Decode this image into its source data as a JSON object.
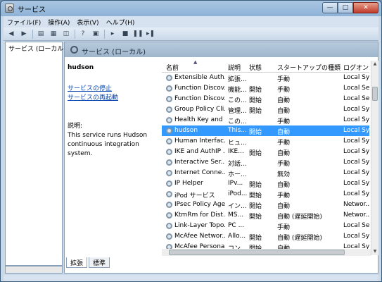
{
  "window": {
    "title": "サービス",
    "min": "—",
    "max": "□",
    "close": "✕"
  },
  "menu": [
    "ファイル(F)",
    "操作(A)",
    "表示(V)",
    "ヘルプ(H)"
  ],
  "toolbar": [
    "back-arrow-icon",
    "forward-arrow-icon",
    "console-tree-icon",
    "refresh-icon",
    "export-icon",
    "help-icon",
    "properties-icon",
    "play-icon",
    "stop-icon",
    "pause-icon",
    "restart-icon"
  ],
  "tree": {
    "root_label": "サービス (ローカル)"
  },
  "main": {
    "header": "サービス (ローカル)"
  },
  "extended": {
    "service_name": "hudson",
    "stop_link": "サービスの停止",
    "restart_link": "サービスの再起動",
    "desc_label": "説明:",
    "desc_text": "This service runs Hudson continuous integration system."
  },
  "columns": {
    "name": "名前",
    "desc": "説明",
    "status": "状態",
    "startup": "スタートアップの種類",
    "logon": "ログオン"
  },
  "rows": [
    {
      "name": "Extensible Auth...",
      "desc": "拡張...",
      "status": "",
      "startup": "手動",
      "logon": "Local Sy..."
    },
    {
      "name": "Function Discov...",
      "desc": "機能...",
      "status": "開始",
      "startup": "手動",
      "logon": "Local Se..."
    },
    {
      "name": "Function Discov...",
      "desc": "この...",
      "status": "開始",
      "startup": "自動",
      "logon": "Local Se..."
    },
    {
      "name": "Group Policy Cli...",
      "desc": "管理...",
      "status": "開始",
      "startup": "自動",
      "logon": "Local Sy..."
    },
    {
      "name": "Health Key and ...",
      "desc": "この...",
      "status": "",
      "startup": "手動",
      "logon": "Local Sy..."
    },
    {
      "name": "hudson",
      "desc": "This...",
      "status": "開始",
      "startup": "自動",
      "logon": "Local Sy...",
      "selected": true
    },
    {
      "name": "Human Interfac...",
      "desc": "ヒュ...",
      "status": "",
      "startup": "手動",
      "logon": "Local Sy..."
    },
    {
      "name": "IKE and AuthIP ...",
      "desc": "IKE...",
      "status": "開始",
      "startup": "自動",
      "logon": "Local Sy..."
    },
    {
      "name": "Interactive Ser...",
      "desc": "対話...",
      "status": "",
      "startup": "手動",
      "logon": "Local Sy..."
    },
    {
      "name": "Internet Conne...",
      "desc": "ホー...",
      "status": "",
      "startup": "無効",
      "logon": "Local Sy..."
    },
    {
      "name": "IP Helper",
      "desc": "IPv...",
      "status": "開始",
      "startup": "自動",
      "logon": "Local Sy..."
    },
    {
      "name": "iPod サービス",
      "desc": "iPod...",
      "status": "開始",
      "startup": "手動",
      "logon": "Local Sy..."
    },
    {
      "name": "IPsec Policy Agent",
      "desc": "イン...",
      "status": "開始",
      "startup": "自動",
      "logon": "Networ..."
    },
    {
      "name": "KtmRm for Dist...",
      "desc": "MS...",
      "status": "開始",
      "startup": "自動 (遅延開始)",
      "logon": "Networ..."
    },
    {
      "name": "Link-Layer Topo...",
      "desc": "PC ...",
      "status": "",
      "startup": "手動",
      "logon": "Local Se..."
    },
    {
      "name": "McAfee Networ...",
      "desc": "Allo...",
      "status": "開始",
      "startup": "自動 (遅延開始)",
      "logon": "Local Sy..."
    },
    {
      "name": "McAfee Persona...",
      "desc": "コン...",
      "status": "開始",
      "startup": "自動",
      "logon": "Local Sy..."
    }
  ],
  "tabs": [
    "拡張",
    "標準"
  ],
  "colors": {
    "selection": "#3399ff",
    "link": "#0645ad"
  }
}
